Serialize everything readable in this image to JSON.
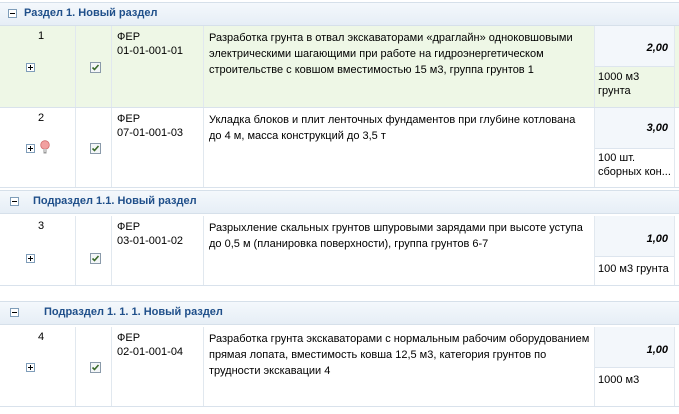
{
  "sections": [
    {
      "title": "Раздел 1. Новый раздел"
    },
    {
      "title": "Подраздел 1.1. Новый раздел"
    },
    {
      "title": "Подраздел 1. 1. 1. Новый раздел"
    }
  ],
  "rows": [
    {
      "num": "1",
      "code": "ФЕР\n01-01-001-01",
      "description": "Разработка грунта в отвал экскаваторами «драглайн» одноковшовыми электрическими шагающими при работе на гидроэнергетическом строительстве с ковшом вместимостью 15 м3, группа грунтов 1",
      "quantity": "2,00",
      "unit": "1000 м3 грунта",
      "checked": true,
      "highlighted": true
    },
    {
      "num": "2",
      "code": "ФЕР\n07-01-001-03",
      "description": "Укладка блоков и плит ленточных фундаментов при глубине котлована до 4 м, масса конструкций до 3,5 т",
      "quantity": "3,00",
      "unit": "100 шт. сборных кон...",
      "checked": true,
      "highlighted": false
    },
    {
      "num": "3",
      "code": "ФЕР\n03-01-001-02",
      "description": "Разрыхление скальных грунтов шпуровыми зарядами при высоте уступа до 0,5 м (планировка поверхности), группа грунтов 6-7",
      "quantity": "1,00",
      "unit": "100 м3 грунта",
      "checked": true,
      "highlighted": false
    },
    {
      "num": "4",
      "code": "ФЕР\n02-01-001-04",
      "description": "Разработка грунта экскаваторами с нормальным рабочим оборудованием прямая лопата, вместимость ковша 12,5 м3, категория грунтов по трудности экскавации 4",
      "quantity": "1,00",
      "unit": "1000 м3",
      "checked": true,
      "highlighted": false
    }
  ],
  "icons": {
    "collapse": "collapse-icon",
    "expand": "expand-icon",
    "checkbox": "checkmark-icon",
    "bulb": "lightbulb-icon"
  },
  "colors": {
    "section_title": "#1f4f8a",
    "highlight_row": "#eef7e6"
  }
}
